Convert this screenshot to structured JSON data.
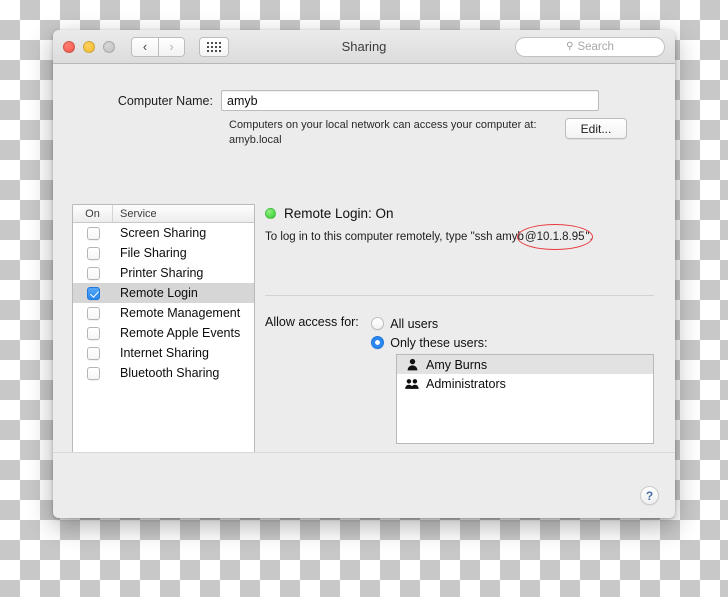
{
  "window": {
    "title": "Sharing",
    "traffic_lights": [
      "close",
      "minimize",
      "zoom"
    ],
    "nav": {
      "back": "‹",
      "forward": "›"
    },
    "grid_button": "all-preferences-grid"
  },
  "search": {
    "icon": "search-icon",
    "placeholder": "Search",
    "value": ""
  },
  "computer_name": {
    "label": "Computer Name:",
    "value": "amyb",
    "description": "Computers on your local network can access your computer at: amyb.local",
    "edit_label": "Edit..."
  },
  "service_table": {
    "headers": {
      "on": "On",
      "service": "Service"
    },
    "rows": [
      {
        "label": "Screen Sharing",
        "checked": false,
        "selected": false
      },
      {
        "label": "File Sharing",
        "checked": false,
        "selected": false
      },
      {
        "label": "Printer Sharing",
        "checked": false,
        "selected": false
      },
      {
        "label": "Remote Login",
        "checked": true,
        "selected": true
      },
      {
        "label": "Remote Management",
        "checked": false,
        "selected": false
      },
      {
        "label": "Remote Apple Events",
        "checked": false,
        "selected": false
      },
      {
        "label": "Internet Sharing",
        "checked": false,
        "selected": false
      },
      {
        "label": "Bluetooth Sharing",
        "checked": false,
        "selected": false
      }
    ]
  },
  "detail": {
    "status_text": "Remote Login: On",
    "status_color": "#33cc33",
    "ssh_prefix": "To log in to this computer remotely, type \"ssh amyb",
    "ssh_highlight": "@10.1.8.95",
    "ssh_suffix": "\".",
    "annotation_color": "#e8383c",
    "allow_label": "Allow access for:",
    "radio_all_users": "All users",
    "radio_only_these": "Only these users:",
    "selected_radio": "only_these",
    "users": [
      {
        "name": "Amy Burns",
        "icon": "single-user-icon",
        "glyph": "\u0001",
        "selected": true
      },
      {
        "name": "Administrators",
        "icon": "user-group-icon",
        "glyph": "\u0002",
        "selected": false
      }
    ],
    "add_label": "+",
    "remove_label": "−"
  },
  "bottom": {
    "help_label": "?"
  }
}
